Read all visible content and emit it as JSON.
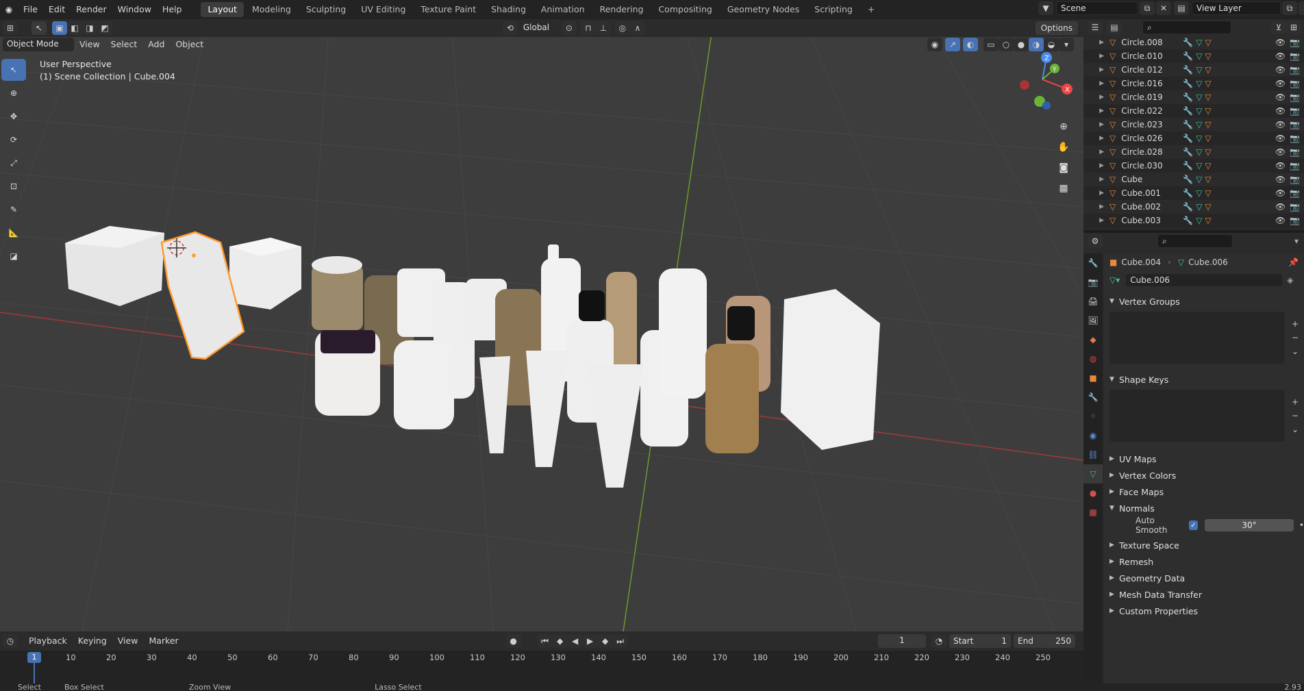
{
  "topbar": {
    "menus": [
      "File",
      "Edit",
      "Render",
      "Window",
      "Help"
    ],
    "workspaces": [
      "Layout",
      "Modeling",
      "Sculpting",
      "UV Editing",
      "Texture Paint",
      "Shading",
      "Animation",
      "Rendering",
      "Compositing",
      "Geometry Nodes",
      "Scripting"
    ],
    "active_workspace": "Layout",
    "scene": "Scene",
    "view_layer": "View Layer"
  },
  "viewport_header": {
    "mode": "Object Mode",
    "menus": [
      "View",
      "Select",
      "Add",
      "Object"
    ],
    "transform_orientation": "Global",
    "options_label": "Options"
  },
  "viewport": {
    "view_name": "User Perspective",
    "collection_info": "(1) Scene Collection | Cube.004",
    "gizmo_axes": {
      "x": "X",
      "y": "Y",
      "z": "Z"
    }
  },
  "outliner": {
    "items": [
      {
        "name": "Circle.008"
      },
      {
        "name": "Circle.010"
      },
      {
        "name": "Circle.012"
      },
      {
        "name": "Circle.016"
      },
      {
        "name": "Circle.019"
      },
      {
        "name": "Circle.022"
      },
      {
        "name": "Circle.023"
      },
      {
        "name": "Circle.026"
      },
      {
        "name": "Circle.028"
      },
      {
        "name": "Circle.030"
      },
      {
        "name": "Cube"
      },
      {
        "name": "Cube.001"
      },
      {
        "name": "Cube.002"
      },
      {
        "name": "Cube.003"
      }
    ]
  },
  "properties": {
    "breadcrumb_object": "Cube.004",
    "breadcrumb_mesh": "Cube.006",
    "mesh_name": "Cube.006",
    "panels": {
      "vertex_groups": "Vertex Groups",
      "shape_keys": "Shape Keys",
      "uv_maps": "UV Maps",
      "vertex_colors": "Vertex Colors",
      "face_maps": "Face Maps",
      "normals": "Normals",
      "texture_space": "Texture Space",
      "remesh": "Remesh",
      "geometry_data": "Geometry Data",
      "mesh_data_transfer": "Mesh Data Transfer",
      "custom_properties": "Custom Properties"
    },
    "auto_smooth_label": "Auto Smooth",
    "auto_smooth_angle": "30°"
  },
  "timeline": {
    "menus": [
      "Playback",
      "Keying",
      "View",
      "Marker"
    ],
    "current_frame": "1",
    "start_label": "Start",
    "start_value": "1",
    "end_label": "End",
    "end_value": "250",
    "ticks": [
      "10",
      "20",
      "30",
      "40",
      "50",
      "60",
      "70",
      "80",
      "90",
      "100",
      "110",
      "120",
      "130",
      "140",
      "150",
      "160",
      "170",
      "180",
      "190",
      "200",
      "210",
      "220",
      "230",
      "240",
      "250"
    ],
    "playhead": "1"
  },
  "statusbar": {
    "select": "Select",
    "box_select": "Box Select",
    "zoom_view": "Zoom View",
    "lasso_select": "Lasso Select",
    "version": "2.93"
  }
}
